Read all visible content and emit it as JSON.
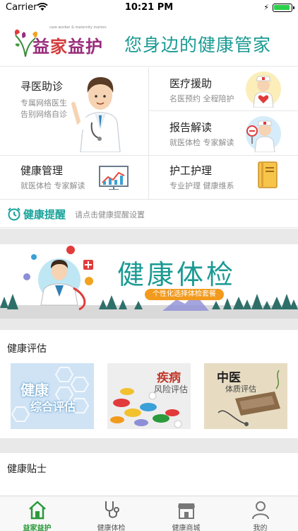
{
  "status_bar": {
    "carrier": "Carrier",
    "time": "10:21 PM",
    "battery_level": 1.0
  },
  "header": {
    "logo_text_1": "益",
    "logo_text_2": "家",
    "logo_text_3": "益护",
    "logo_subtext": "care worker & maternity matron",
    "slogan": "您身边的健康管家"
  },
  "services": [
    {
      "title": "寻医助诊",
      "sub1": "专属网络医生",
      "sub2": "告别网络自诊",
      "icon": "doctor-pointing-icon"
    },
    {
      "title": "医疗援助",
      "sub": "名医预约 全程陪护",
      "icon": "doctor-heart-icon"
    },
    {
      "title": "报告解读",
      "sub": "就医体检 专家解读",
      "icon": "doctor-sign-icon"
    },
    {
      "title": "健康管理",
      "sub": "就医体检 专家解读",
      "icon": "chart-board-icon"
    },
    {
      "title": "护工护理",
      "sub": "专业护理 健康维系",
      "icon": "notebook-icon"
    }
  ],
  "reminder": {
    "label": "健康提醒",
    "hint": "请点击健康提醒设置"
  },
  "banner": {
    "title": "健康体检",
    "tagline": "个性化选择体检套餐"
  },
  "evaluation": {
    "title": "健康评估",
    "cards": [
      {
        "line1": "健康",
        "line2": "综合评估"
      },
      {
        "line1": "疾病",
        "line2": "风险评估"
      },
      {
        "line1": "中医",
        "line2": "体质评估"
      }
    ]
  },
  "tips": {
    "title": "健康贴士"
  },
  "tabs": [
    {
      "label": "益家益护",
      "icon": "home-icon",
      "active": true
    },
    {
      "label": "健康体检",
      "icon": "stethoscope-icon",
      "active": false
    },
    {
      "label": "健康商城",
      "icon": "shop-icon",
      "active": false
    },
    {
      "label": "我的",
      "icon": "user-icon",
      "active": false
    }
  ],
  "colors": {
    "accent": "#1a9a93",
    "tab_active": "#2a9a3a",
    "pill": "#f29a1d"
  }
}
